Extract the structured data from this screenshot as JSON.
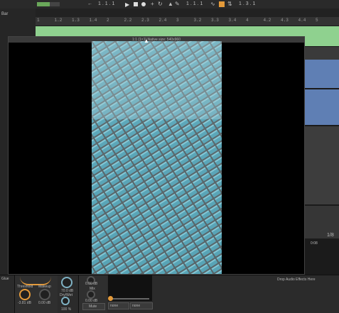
{
  "transport": {
    "position_left": "1 . 1 . 1",
    "position_right": "1 . 1 . 1",
    "loop_end": "1 . 3 . 1"
  },
  "ruler": [
    "1",
    "1.2",
    "1.3",
    "1.4",
    "2",
    "2.2",
    "2.3",
    "2.4",
    "3",
    "3.2",
    "3.3",
    "3.4",
    "4",
    "4.2",
    "4.3",
    "4.4",
    "5"
  ],
  "left_labels": {
    "track_name": "Bar"
  },
  "video": {
    "title": "1:1 (1×1) Native size: 540x960"
  },
  "right_side": {
    "ratio": "1/8",
    "time": "0:08"
  },
  "devices": {
    "group_label": "Glue",
    "threshold_label": "Threshold",
    "threshold_value": "-3.81 dB",
    "makeup_label": "Makeup",
    "makeup_value": "0.00 dB",
    "knob3_value": "70.0 dB",
    "drywet_label": "Dry/Wet",
    "drywet_value": "100 %",
    "gain_value": "0.00 dB",
    "mix_label": "Mix",
    "mix_value": "0.00 dB",
    "mode_a": "none",
    "mode_b": "none",
    "mute_label": "Mute",
    "drop_hint": "Drop Audio Effects Here"
  },
  "colors": {
    "green_lane": "#8fd18f",
    "blue_lane": "#5f7fb4",
    "accent": "#e49a3a"
  }
}
